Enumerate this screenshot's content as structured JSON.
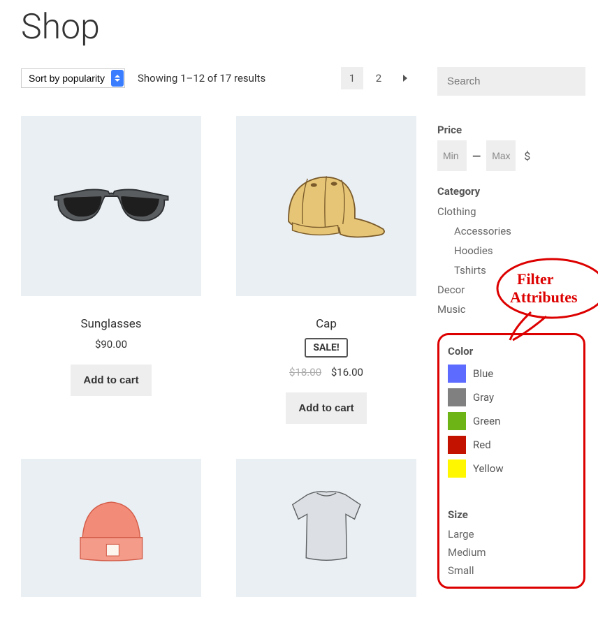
{
  "page_title": "Shop",
  "toolbar": {
    "sort_label": "Sort by popularity",
    "result_count": "Showing 1–12 of 17 results",
    "add_to_cart_label": "Add to cart"
  },
  "pagination": {
    "pages": [
      "1",
      "2"
    ],
    "current": "1"
  },
  "products": [
    {
      "title": "Sunglasses",
      "price": "$90.00",
      "on_sale": false
    },
    {
      "title": "Cap",
      "old_price": "$18.00",
      "price": "$16.00",
      "on_sale": true,
      "sale_label": "SALE!"
    }
  ],
  "search": {
    "placeholder": "Search"
  },
  "price_filter": {
    "heading": "Price",
    "min_placeholder": "Min",
    "max_placeholder": "Max",
    "dash": "—",
    "currency": "$"
  },
  "category_filter": {
    "heading": "Category",
    "items": [
      {
        "label": "Clothing",
        "level": 0
      },
      {
        "label": "Accessories",
        "level": 1
      },
      {
        "label": "Hoodies",
        "level": 1
      },
      {
        "label": "Tshirts",
        "level": 1
      },
      {
        "label": "Decor",
        "level": 0
      },
      {
        "label": "Music",
        "level": 0
      }
    ]
  },
  "color_filter": {
    "heading": "Color",
    "items": [
      {
        "label": "Blue",
        "hex": "#5d6bff"
      },
      {
        "label": "Gray",
        "hex": "#808080"
      },
      {
        "label": "Green",
        "hex": "#6db516"
      },
      {
        "label": "Red",
        "hex": "#c41200"
      },
      {
        "label": "Yellow",
        "hex": "#fff700"
      }
    ]
  },
  "size_filter": {
    "heading": "Size",
    "items": [
      "Large",
      "Medium",
      "Small"
    ]
  },
  "callout": {
    "line1": "Filter",
    "line2": "Attributes"
  }
}
